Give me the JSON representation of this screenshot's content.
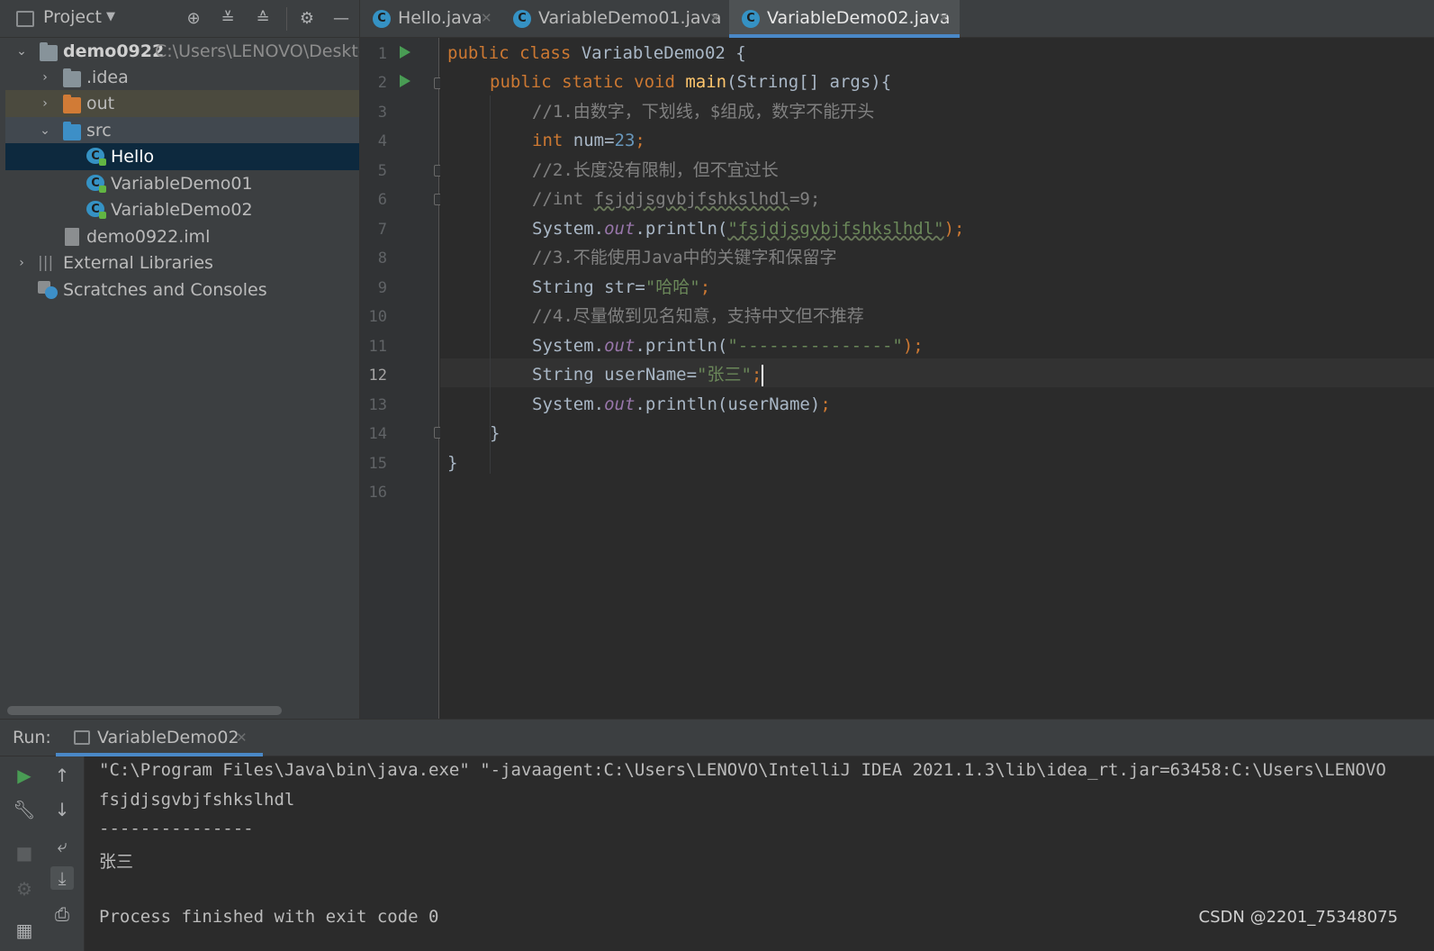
{
  "sidebar": {
    "title": "Project",
    "tree": [
      {
        "label": "demo0922",
        "path": "C:\\Users\\LENOVO\\Desktop",
        "type": "module",
        "expanded": true
      },
      {
        "label": ".idea",
        "type": "folder",
        "expanded": false
      },
      {
        "label": "out",
        "type": "folder-excluded",
        "expanded": false
      },
      {
        "label": "src",
        "type": "folder-source",
        "expanded": true
      },
      {
        "label": "Hello",
        "type": "class",
        "selected": true
      },
      {
        "label": "VariableDemo01",
        "type": "class"
      },
      {
        "label": "VariableDemo02",
        "type": "class"
      },
      {
        "label": "demo0922.iml",
        "type": "file"
      },
      {
        "label": "External Libraries",
        "type": "libraries",
        "expanded": false
      },
      {
        "label": "Scratches and Consoles",
        "type": "scratches"
      }
    ]
  },
  "tabs": [
    {
      "label": "Hello.java",
      "active": false
    },
    {
      "label": "VariableDemo01.java",
      "active": false
    },
    {
      "label": "VariableDemo02.java",
      "active": true
    }
  ],
  "editor": {
    "current_line": 12,
    "line_numbers": [
      "1",
      "2",
      "3",
      "4",
      "5",
      "6",
      "7",
      "8",
      "9",
      "10",
      "11",
      "12",
      "13",
      "14",
      "15",
      "16"
    ],
    "lines": {
      "l1": {
        "a": "public class ",
        "b": "VariableDemo02 {"
      },
      "l2": {
        "a": "public static void ",
        "b": "main",
        "c": "(String[] args){"
      },
      "l3": "//1.由数字，下划线，$组成，数字不能开头",
      "l4": {
        "a": "int ",
        "b": "num=",
        "c": "23",
        "d": ";"
      },
      "l5": "//2.长度没有限制，但不宜过长",
      "l6": {
        "a": "//int ",
        "b": "fsjdjsgvbjfshkslhdl",
        "c": "=9;"
      },
      "l7": {
        "a": "System.",
        "b": "out",
        "c": ".println(",
        "d": "\"fsjdjsgvbjfshkslhdl\"",
        "e": ");"
      },
      "l8": "//3.不能使用Java中的关键字和保留字",
      "l9": {
        "a": "String str=",
        "b": "\"哈哈\"",
        "c": ";"
      },
      "l10": "//4.尽量做到见名知意，支持中文但不推荐",
      "l11": {
        "a": "System.",
        "b": "out",
        "c": ".println(",
        "d": "\"---------------\"",
        "e": ");"
      },
      "l12": {
        "a": "String userName=",
        "b": "\"张三\"",
        "c": ";"
      },
      "l13": {
        "a": "System.",
        "b": "out",
        "c": ".println(userName)",
        "d": ";"
      },
      "l14": "}",
      "l15": "}"
    }
  },
  "run": {
    "label": "Run:",
    "tab_label": "VariableDemo02",
    "output": [
      "\"C:\\Program Files\\Java\\bin\\java.exe\" \"-javaagent:C:\\Users\\LENOVO\\IntelliJ IDEA 2021.1.3\\lib\\idea_rt.jar=63458:C:\\Users\\LENOVO",
      "fsjdjsgvbjfshkslhdl",
      "---------------",
      "张三",
      "",
      "Process finished with exit code 0"
    ]
  },
  "watermark": "CSDN @2201_75348075",
  "colors": {
    "keyword": "#cc7832",
    "method": "#ffc66d",
    "comment": "#808080",
    "number": "#6897bb",
    "string": "#6a8759",
    "field": "#9876aa",
    "accent": "#4a88c7"
  }
}
